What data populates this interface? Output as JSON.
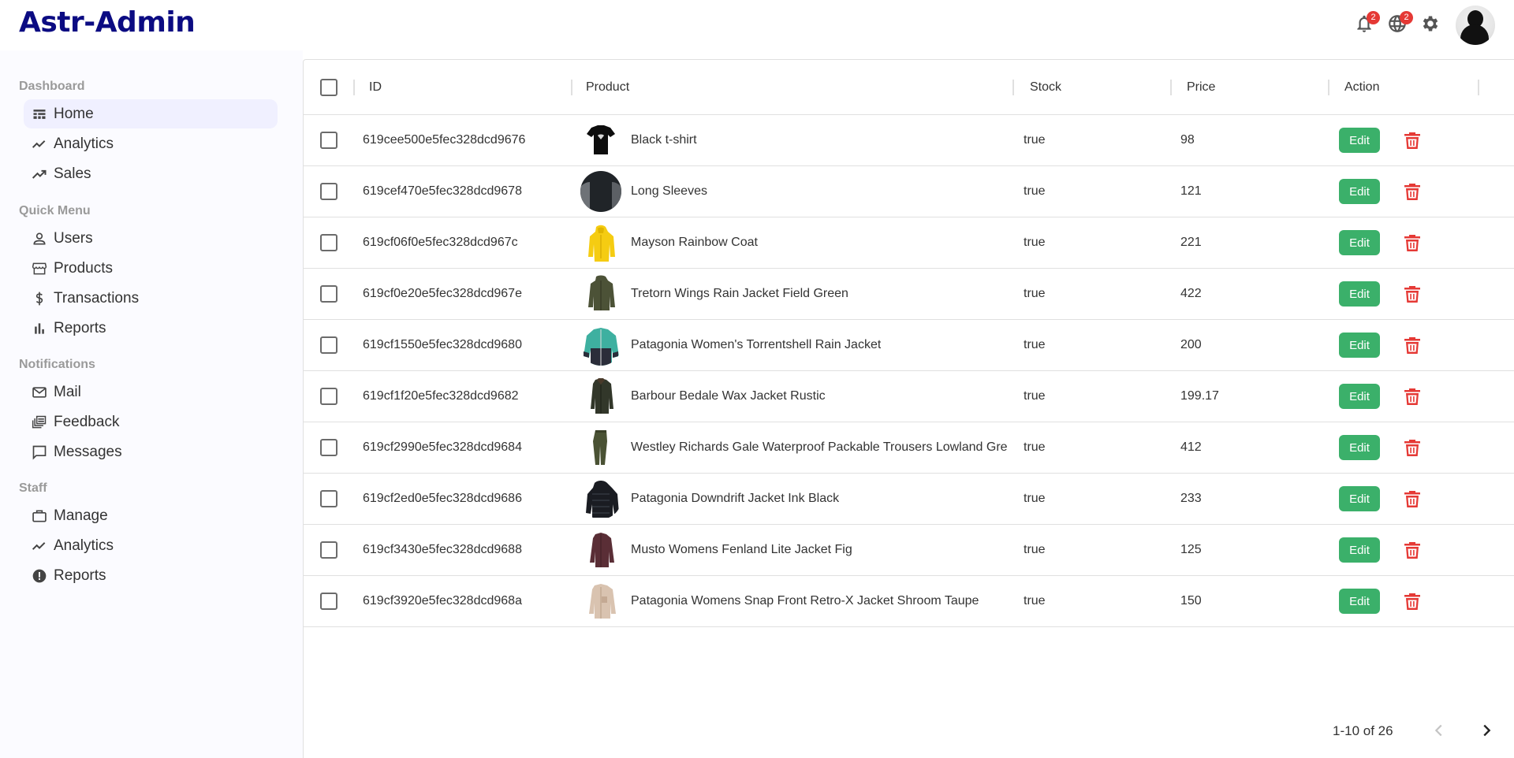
{
  "app": {
    "logo": "Astr-Admin"
  },
  "topbar": {
    "notifications_count": "2",
    "language_count": "2"
  },
  "sidebar": {
    "sections": [
      {
        "title": "Dashboard",
        "items": [
          "Home",
          "Analytics",
          "Sales"
        ]
      },
      {
        "title": "Quick Menu",
        "items": [
          "Users",
          "Products",
          "Transactions",
          "Reports"
        ]
      },
      {
        "title": "Notifications",
        "items": [
          "Mail",
          "Feedback",
          "Messages"
        ]
      },
      {
        "title": "Staff",
        "items": [
          "Manage",
          "Analytics",
          "Reports"
        ]
      }
    ],
    "active_item": "Home"
  },
  "table": {
    "columns": [
      "ID",
      "Product",
      "Stock",
      "Price",
      "Action"
    ],
    "edit_label": "Edit",
    "rows": [
      {
        "id": "619cee500e5fec328dcd9676",
        "product": "Black t-shirt",
        "stock": "true",
        "price": "98",
        "thumb": "black-tshirt"
      },
      {
        "id": "619cef470e5fec328dcd9678",
        "product": "Long Sleeves",
        "stock": "true",
        "price": "121",
        "thumb": "long-sleeves"
      },
      {
        "id": "619cf06f0e5fec328dcd967c",
        "product": "Mayson Rainbow Coat",
        "stock": "true",
        "price": "221",
        "thumb": "yellow-coat"
      },
      {
        "id": "619cf0e20e5fec328dcd967e",
        "product": "Tretorn Wings Rain Jacket Field Green",
        "stock": "true",
        "price": "422",
        "thumb": "green-jacket"
      },
      {
        "id": "619cf1550e5fec328dcd9680",
        "product": "Patagonia Women's Torrentshell Rain Jacket",
        "stock": "true",
        "price": "200",
        "thumb": "teal-jacket"
      },
      {
        "id": "619cf1f20e5fec328dcd9682",
        "product": "Barbour Bedale Wax Jacket Rustic",
        "stock": "true",
        "price": "199.17",
        "thumb": "wax-jacket"
      },
      {
        "id": "619cf2990e5fec328dcd9684",
        "product": "Westley Richards Gale Waterproof Packable Trousers Lowland Gre",
        "stock": "true",
        "price": "412",
        "thumb": "trousers"
      },
      {
        "id": "619cf2ed0e5fec328dcd9686",
        "product": "Patagonia Downdrift Jacket Ink Black",
        "stock": "true",
        "price": "233",
        "thumb": "down-jacket"
      },
      {
        "id": "619cf3430e5fec328dcd9688",
        "product": "Musto Womens Fenland Lite Jacket Fig",
        "stock": "true",
        "price": "125",
        "thumb": "fig-jacket"
      },
      {
        "id": "619cf3920e5fec328dcd968a",
        "product": "Patagonia Womens Snap Front Retro-X Jacket Shroom Taupe",
        "stock": "true",
        "price": "150",
        "thumb": "fleece-jacket"
      }
    ]
  },
  "pagination": {
    "label": "1-10 of 26"
  },
  "colors": {
    "brand": "#0b0b82",
    "edit": "#3bb06a",
    "delete": "#e53935",
    "badge": "#e53935",
    "active_bg": "#f0f0ff"
  }
}
